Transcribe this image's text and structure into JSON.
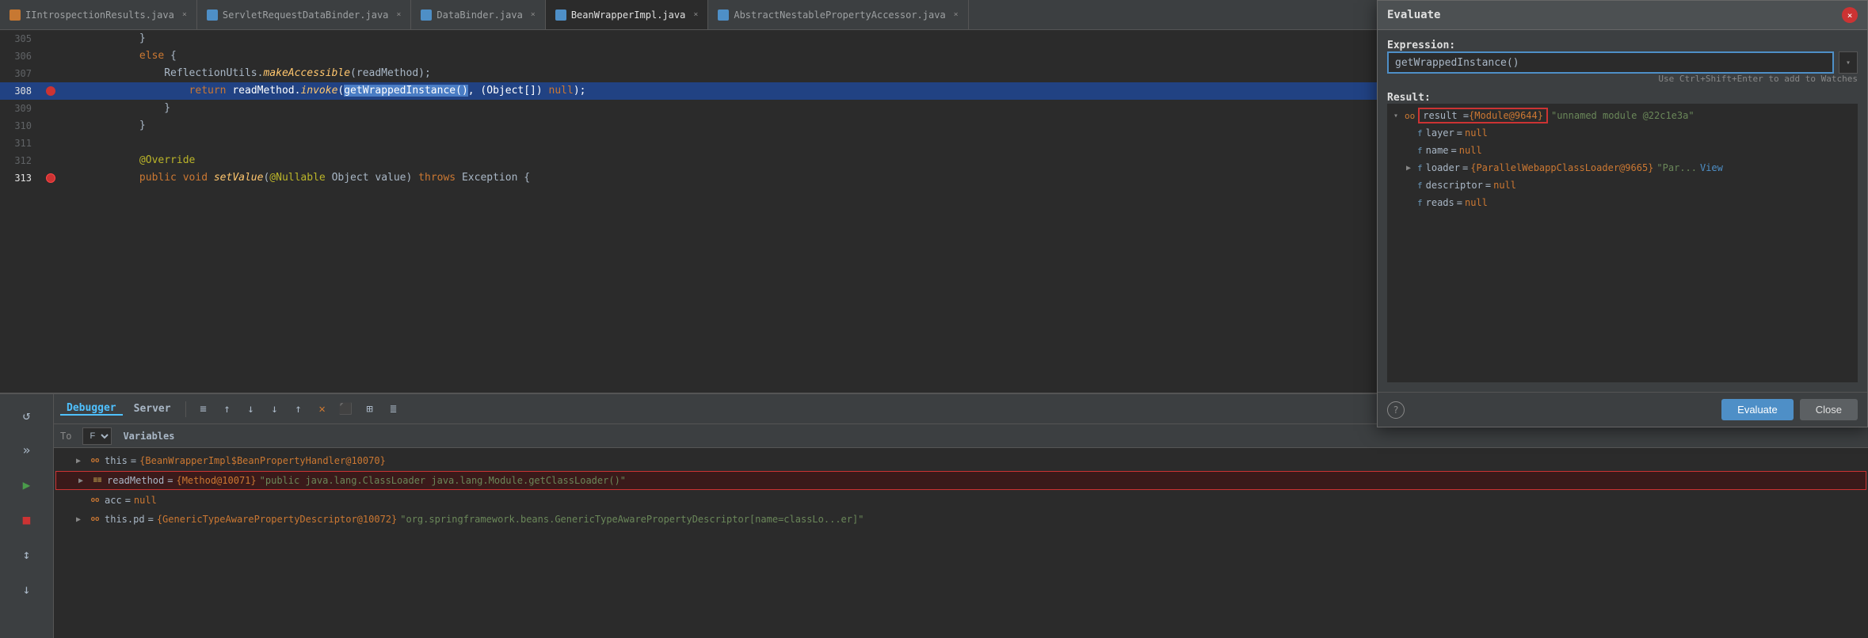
{
  "tabs": [
    {
      "id": "tab1",
      "label": "IntrospectionResults.java",
      "active": false,
      "iconColor": "orange"
    },
    {
      "id": "tab2",
      "label": "ServletRequestDataBinder.java",
      "active": false,
      "iconColor": "blue"
    },
    {
      "id": "tab3",
      "label": "DataBinder.java",
      "active": false,
      "iconColor": "blue"
    },
    {
      "id": "tab4",
      "label": "BeanWrapperImpl.java",
      "active": true,
      "iconColor": "blue"
    },
    {
      "id": "tab5",
      "label": "AbstractNestablePropertyAccessor.java",
      "active": false,
      "iconColor": "blue"
    }
  ],
  "code_lines": [
    {
      "num": "305",
      "content": "                }",
      "type": "normal"
    },
    {
      "num": "306",
      "content": "            else {",
      "type": "normal"
    },
    {
      "num": "307",
      "content": "                ReflectionUtils.makeAccessible(readMethod);",
      "type": "normal"
    },
    {
      "num": "308",
      "content": "                    return readMethod.invoke(getWrappedInstance(), (Object[]) null);",
      "type": "highlighted_breakpoint"
    },
    {
      "num": "309",
      "content": "                }",
      "type": "normal"
    },
    {
      "num": "310",
      "content": "            }",
      "type": "normal"
    },
    {
      "num": "311",
      "content": "",
      "type": "normal"
    },
    {
      "num": "312",
      "content": "            @Override",
      "type": "normal"
    },
    {
      "num": "313",
      "content": "            public void setValue(@Nullable Object value) throws Exception {",
      "type": "normal"
    }
  ],
  "evaluate_dialog": {
    "title": "Evaluate",
    "expression_label": "Expression:",
    "expression_value": "getWrappedInstance()",
    "hint": "Use Ctrl+Shift+Enter to add to Watches",
    "result_label": "Result:",
    "result_tree": [
      {
        "indent": 0,
        "expand": "▾",
        "key": "",
        "has_highlight": true,
        "highlight_text": "result = {Module@9644}",
        "extra": " \"unnamed module @22c1e3a\"",
        "icon": "oo"
      },
      {
        "indent": 1,
        "expand": "",
        "key": "ᶠ layer",
        "eq": "=",
        "value": "null",
        "value_type": "null",
        "icon": "f"
      },
      {
        "indent": 1,
        "expand": "",
        "key": "ᶠ name",
        "eq": "=",
        "value": "null",
        "value_type": "null",
        "icon": "f"
      },
      {
        "indent": 1,
        "expand": "▶",
        "key": "ᶠ loader",
        "eq": "=",
        "value": "{ParallelWebappClassLoader@9665} \"Par...  View",
        "value_type": "obj",
        "icon": "f"
      },
      {
        "indent": 1,
        "expand": "",
        "key": "ᶠ descriptor",
        "eq": "=",
        "value": "null",
        "value_type": "null",
        "icon": "f"
      },
      {
        "indent": 1,
        "expand": "",
        "key": "ᶠ reads",
        "eq": "=",
        "value": "null",
        "value_type": "null",
        "icon": "f"
      }
    ],
    "evaluate_btn": "Evaluate",
    "close_btn": "Close"
  },
  "bottom_panel": {
    "tabs": [
      "Debugger",
      "Server"
    ],
    "active_tab": "Debugger",
    "frame_label": "F",
    "variables_label": "Variables",
    "variables": [
      {
        "indent": 0,
        "expand": "▶",
        "icon": "oo",
        "name": "this",
        "eq": "=",
        "value": "{BeanWrapperImpl$BeanPropertyHandler@10070}",
        "highlighted": false
      },
      {
        "indent": 0,
        "expand": "▶",
        "icon": "eq",
        "name": "readMethod",
        "eq": "=",
        "value": "{Method@10071} \"public java.lang.ClassLoader java.lang.Module.getClassLoader()\"",
        "highlighted": true
      },
      {
        "indent": 0,
        "expand": "",
        "icon": "oo",
        "name": "acc",
        "eq": "=",
        "value": "null",
        "highlighted": false
      },
      {
        "indent": 0,
        "expand": "▶",
        "icon": "oo",
        "name": "this.pd",
        "eq": "=",
        "value": "{GenericTypeAwarePropertyDescriptor@10072} \"org.springframework.beans.GenericTypeAwarePropertyDescriptor[name=classLo...er]\"",
        "highlighted": false
      }
    ]
  },
  "left_panel": {
    "icons": [
      "↺",
      "»",
      "▶",
      "■",
      "⬛",
      "↕",
      "↓"
    ]
  }
}
